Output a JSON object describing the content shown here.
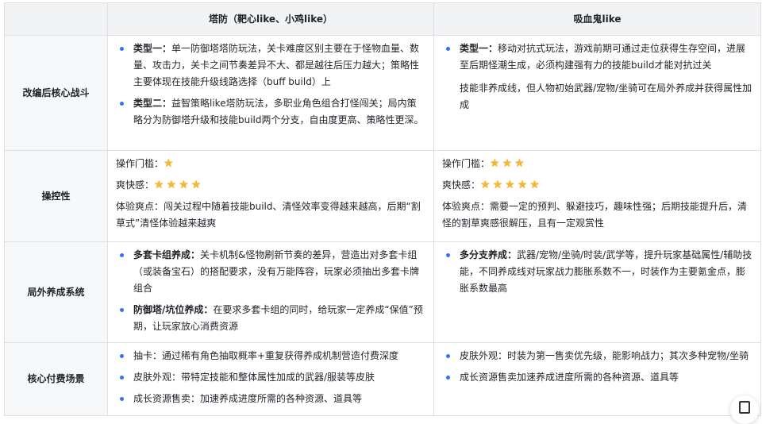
{
  "header": {
    "col0": "",
    "col1": "塔防（靶心like、小鸡like）",
    "col2": "吸血鬼like"
  },
  "rows": [
    {
      "label": "改编后核心战斗",
      "left": [
        {
          "bold": "类型一：",
          "text": "单一防御塔塔防玩法，关卡难度区别主要在于怪物血量、数量、攻击力，关卡之间节奏差异不大、都是越往后压力越大；策略性主要体现在技能升级线路选择（buff build）上"
        },
        {
          "bold": "类型二：",
          "text": "益智策略like塔防玩法，多职业角色组合打怪闯关；局内策略分为防御塔升级和技能build两个分支，自由度更高、策略性更深。"
        }
      ],
      "right": [
        {
          "bold": "类型一：",
          "text": "移动对抗式玩法，游戏前期可通过走位获得生存空间，进展至后期怪潮生成，必须构建强有力的技能build才能对抗过关"
        }
      ],
      "right_extra": "技能非养成线，但人物初始武器/宠物/坐骑可在局外养成并获得属性加成"
    },
    {
      "label": "操控性",
      "left": {
        "threshold_label": "操作门槛：",
        "threshold_stars": 1,
        "fun_label": "爽快感：",
        "fun_stars": 4,
        "exp": "体验爽点：闯关过程中随着技能build、清怪效率变得越来越高，后期“割草式”清怪体验越来越爽"
      },
      "right": {
        "threshold_label": "操作门槛：",
        "threshold_stars": 3,
        "fun_label": "爽快感：",
        "fun_stars": 5,
        "exp": "体验爽点：需要一定的预判、躲避技巧，趣味性强；后期技能提升后，清怪的割草爽感很解压，且有一定观赏性"
      }
    },
    {
      "label": "局外养成系统",
      "left": [
        {
          "bold": "多套卡组养成：",
          "text": "关卡机制&怪物刷新节奏的差异，营造出对多套卡组（或装备宝石）的搭配要求，没有万能阵容，玩家必须抽出多套卡牌组合"
        },
        {
          "bold": "防御塔/坑位养成：",
          "text": "在要求多套卡组的同时，给玩家一定养成“保值”预期，让玩家放心消费资源"
        }
      ],
      "right": [
        {
          "bold": "多分支养成：",
          "text": "武器/宠物/坐骑/时装/武学等，提升玩家基础属性/辅助技能，不同养成线对玩家战力膨胀系数不一，时装作为主要氪金点，膨胀系数最高"
        }
      ]
    },
    {
      "label": "核心付费场景",
      "left": [
        "抽卡：通过稀有角色抽取概率+重复获得养成机制营造付费深度",
        "皮肤外观：带特定技能和整体属性加成的武器/服装等皮肤",
        "成长资源售卖：加速养成进度所需的各种资源、道具等"
      ],
      "right": [
        "皮肤外观：时装为第一售卖优先级，能影响战力；其次多种宠物/坐骑",
        "成长资源售卖加速养成进度所需的各种资源、道具等"
      ]
    }
  ],
  "colors": {
    "bullet": "#3370ff",
    "star": "#f5b82e",
    "header_bg": "#f2f3f5"
  }
}
